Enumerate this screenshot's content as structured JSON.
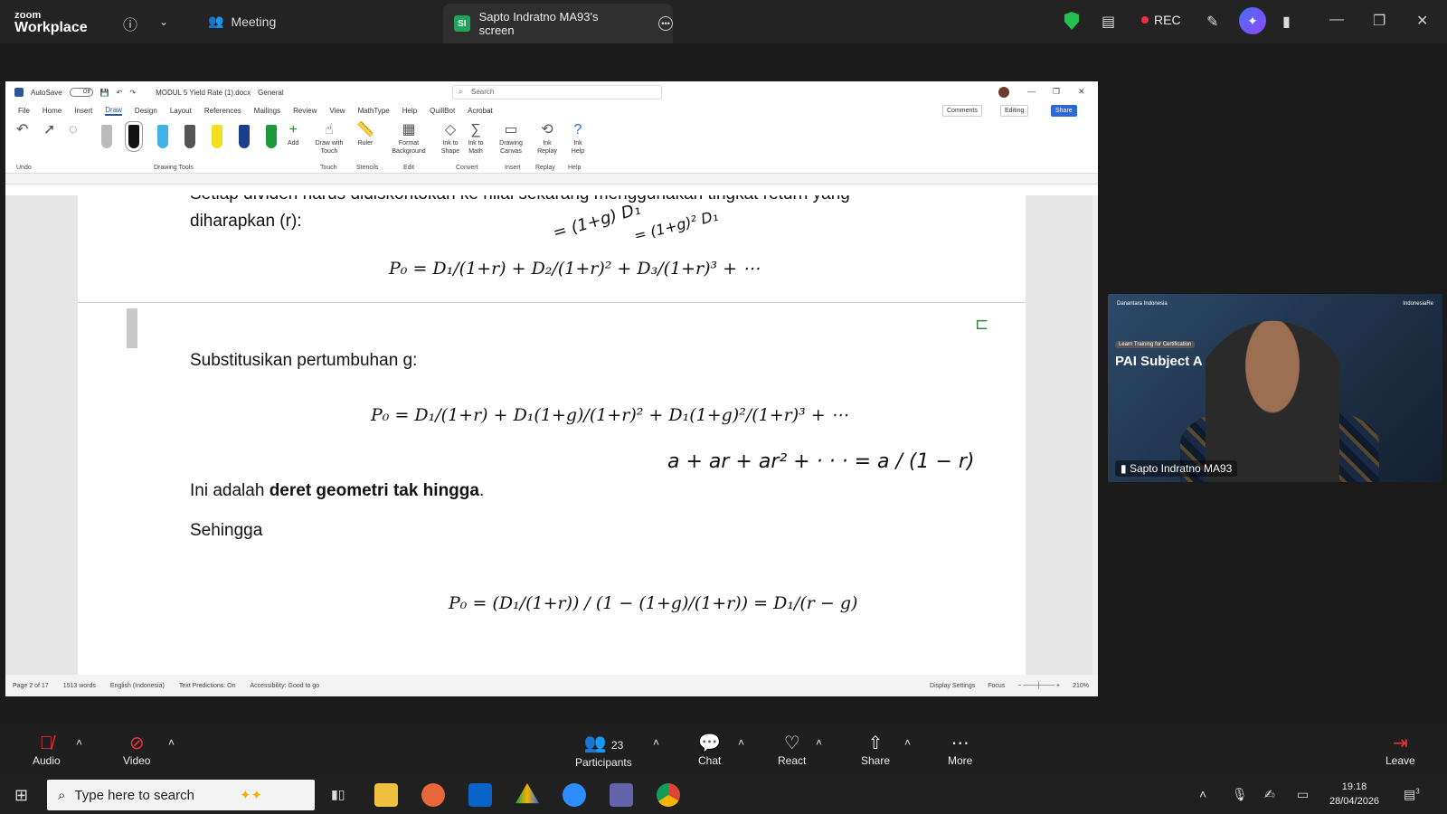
{
  "zoom": {
    "brand_top": "zoom",
    "brand_bottom": "Workplace",
    "meeting_label": "Meeting",
    "share_initials": "SI",
    "share_tab_label": "Sapto Indratno MA93's screen",
    "rec_label": "REC",
    "colors": {
      "accent": "#2b6ad6",
      "rec": "#e8333c",
      "shield": "#25c14f"
    }
  },
  "word": {
    "autosave_label": "AutoSave",
    "autosave_state": "Off",
    "filename": "MODUL 5 Yield Rate (1).docx",
    "sensitivity": "General",
    "search_placeholder": "Search",
    "menu": [
      "File",
      "Home",
      "Insert",
      "Draw",
      "Design",
      "Layout",
      "References",
      "Mailings",
      "Review",
      "View",
      "MathType",
      "Help",
      "QuillBot",
      "Acrobat"
    ],
    "comments_btn": "Comments",
    "editing_btn": "Editing",
    "share_btn": "Share",
    "ribbon_groups": {
      "undo": "Undo",
      "drawing_tools": "Drawing Tools",
      "touch": "Touch",
      "stencils": "Stencils",
      "edit": "Edit",
      "convert": "Convert",
      "insert": "Insert",
      "replay": "Replay",
      "help": "Help"
    },
    "ribbon_tools": {
      "add": "Add",
      "draw_touch": "Draw with Touch",
      "ruler": "Ruler",
      "format_bg": "Format Background",
      "ink_shape": "Ink to Shape",
      "ink_math": "Ink to Math",
      "drawing_canvas": "Drawing Canvas",
      "ink_replay": "Ink Replay",
      "ink_help": "Ink Help"
    },
    "status": {
      "page": "Page 2 of 17",
      "words": "1513 words",
      "language": "English (Indonesia)",
      "predictions": "Text Predictions: On",
      "accessibility": "Accessibility: Good to go",
      "display": "Display Settings",
      "focus": "Focus",
      "zoom": "210%"
    }
  },
  "document": {
    "line_top": "Setiap dividen harus didiskontokan ke nilai sekarang menggunakan tingkat return yang",
    "line_expected": "diharapkan (r):",
    "eq1": "P₀ = D₁/(1+r) + D₂/(1+r)² + D₃/(1+r)³ + ⋯",
    "ink1": "= (1+g) D₁",
    "ink2": "= (1+g)² D₁",
    "line_subst": "Substitusikan pertumbuhan g:",
    "eq2": "P₀ = D₁/(1+r) + D₁(1+g)/(1+r)² + D₁(1+g)²/(1+r)³ + ⋯",
    "ink3": "a + ar + ar² + · · · = a / (1 − r)",
    "line_geo_prefix": "Ini adalah ",
    "line_geo_bold": "deret geometri tak hingga",
    "line_geo_suffix": ".",
    "line_sehingga": "Sehingga",
    "eq3": "P₀ = (D₁/(1+r)) / (1 − (1+g)/(1+r)) = D₁/(r − g)"
  },
  "video": {
    "badge": "Learn Training for Certification",
    "subject": "PAI Subject A",
    "name": "Sapto Indratno MA93",
    "brand_left": "Danantara Indonesia",
    "brand_right": "IndonesiaRe"
  },
  "toolbar": {
    "audio": "Audio",
    "video": "Video",
    "participants": "Participants",
    "participants_count": "23",
    "chat": "Chat",
    "react": "React",
    "share": "Share",
    "more": "More",
    "leave": "Leave"
  },
  "taskbar": {
    "search_placeholder": "Type here to search",
    "time": "19:18",
    "date": "28/04/2026",
    "notifications": "3"
  }
}
